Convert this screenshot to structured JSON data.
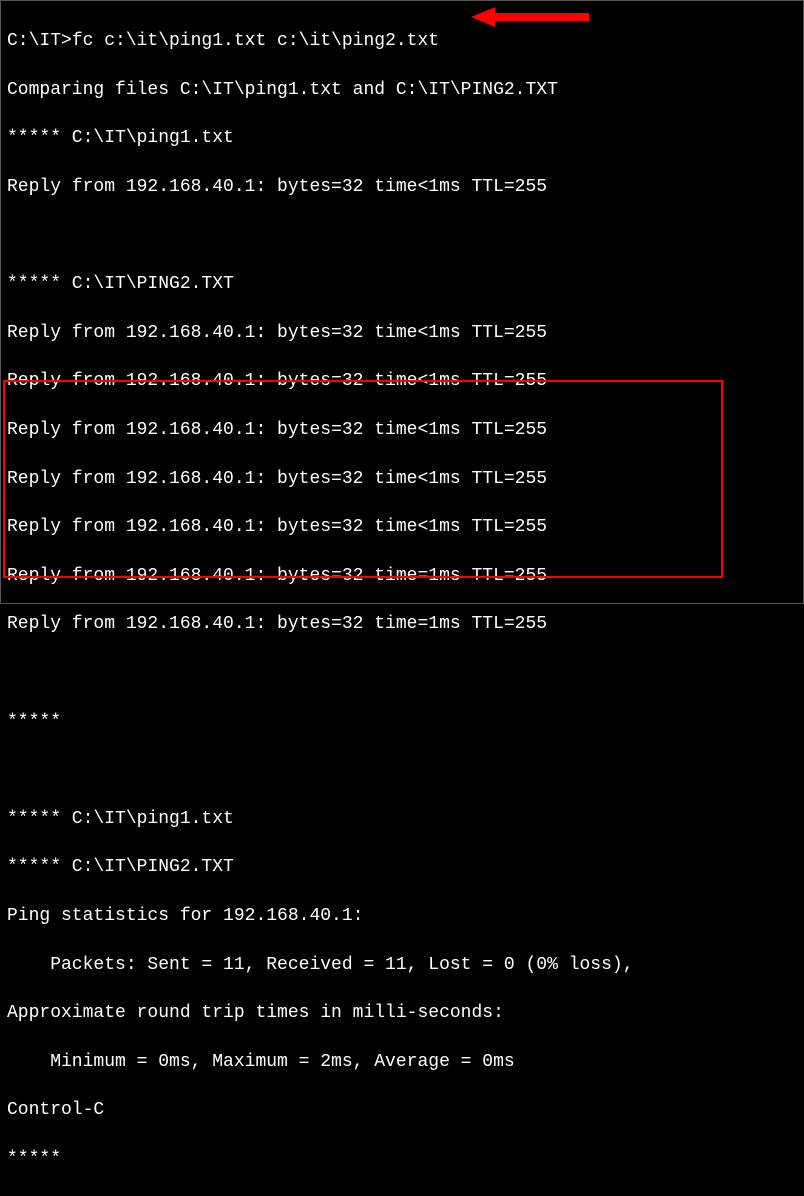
{
  "terminal": {
    "prompt": "C:\\IT>",
    "command": "fc c:\\it\\ping1.txt c:\\it\\ping2.txt",
    "lines": {
      "comparing": "Comparing files C:\\IT\\ping1.txt and C:\\IT\\PING2.TXT",
      "header1": "***** C:\\IT\\ping1.txt",
      "reply1": "Reply from 192.168.40.1: bytes=32 time<1ms TTL=255",
      "blank1": " ",
      "header2": "***** C:\\IT\\PING2.TXT",
      "reply2": "Reply from 192.168.40.1: bytes=32 time<1ms TTL=255",
      "reply3": "Reply from 192.168.40.1: bytes=32 time<1ms TTL=255",
      "reply4": "Reply from 192.168.40.1: bytes=32 time<1ms TTL=255",
      "reply5": "Reply from 192.168.40.1: bytes=32 time<1ms TTL=255",
      "reply6": "Reply from 192.168.40.1: bytes=32 time<1ms TTL=255",
      "reply7": "Reply from 192.168.40.1: bytes=32 time=1ms TTL=255",
      "reply8": "Reply from 192.168.40.1: bytes=32 time=1ms TTL=255",
      "blank2": " ",
      "sep1": "*****",
      "blank3": " ",
      "header3": "***** C:\\IT\\ping1.txt",
      "header4": "***** C:\\IT\\PING2.TXT",
      "stats1": "Ping statistics for 192.168.40.1:",
      "stats2": "    Packets: Sent = 11, Received = 11, Lost = 0 (0% loss),",
      "stats3": "Approximate round trip times in milli-seconds:",
      "stats4": "    Minimum = 0ms, Maximum = 2ms, Average = 0ms",
      "ctrlc": "Control-C",
      "sep2": "*****"
    }
  },
  "annotations": {
    "arrow_color": "#ff0000",
    "box_color": "#ff0000"
  }
}
